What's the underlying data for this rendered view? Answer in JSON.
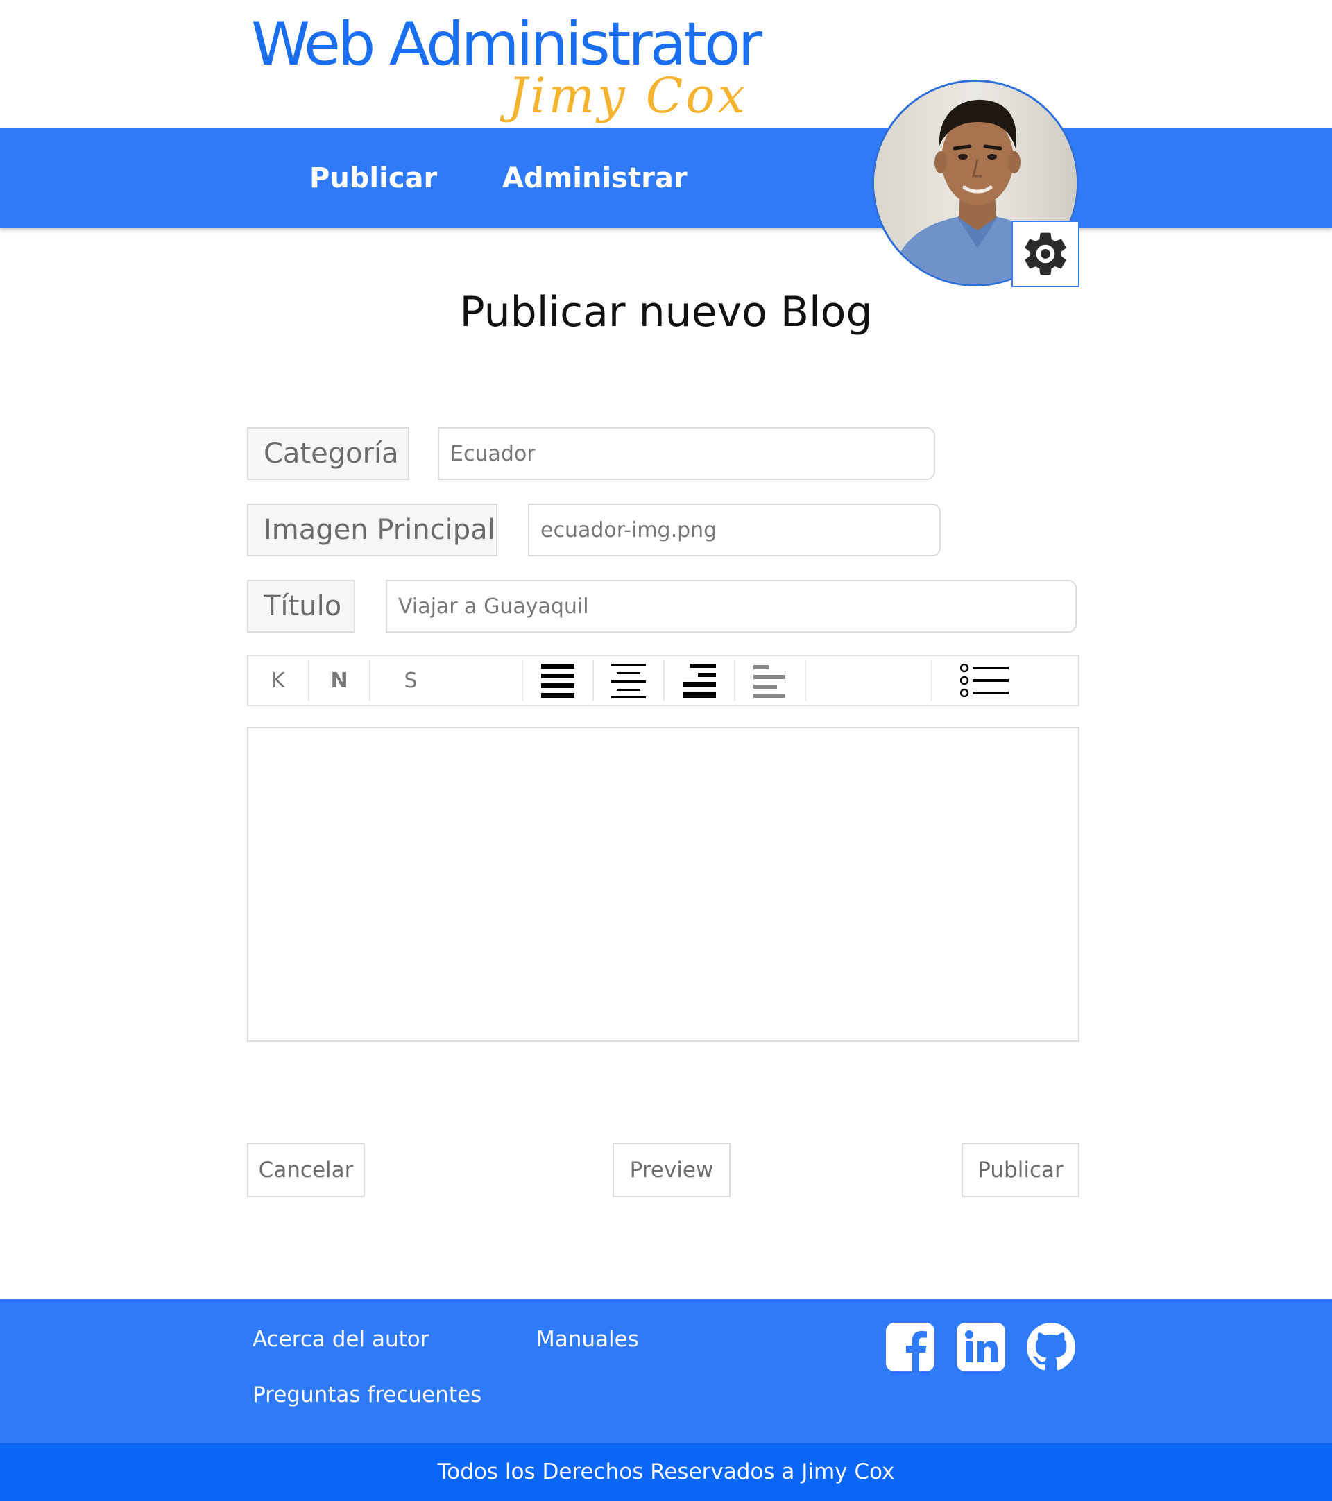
{
  "brand": {
    "title": "Web Administrator",
    "subtitle": "Jimy Cox",
    "primary_color": "#2f7af8",
    "accent_color": "#f5b330"
  },
  "nav": {
    "items": [
      {
        "label": "Publicar"
      },
      {
        "label": "Administrar"
      }
    ]
  },
  "profile": {
    "avatar_icon": "user-photo",
    "settings_icon": "gear-icon"
  },
  "page": {
    "title": "Publicar nuevo Blog"
  },
  "form": {
    "category": {
      "label": "Categoría",
      "value": "Ecuador"
    },
    "image": {
      "label": "Imagen Principal",
      "value": "ecuador-img.png"
    },
    "title": {
      "label": "Título",
      "value": "Viajar a Guayaquil"
    },
    "content": {
      "value": ""
    }
  },
  "toolbar": {
    "italic": "K",
    "bold": "N",
    "underline": "S",
    "icons": [
      "align-justify-icon",
      "align-center-icon",
      "align-right-icon",
      "align-left-icon",
      "list-icon"
    ]
  },
  "actions": {
    "cancel": "Cancelar",
    "preview": "Preview",
    "publish": "Publicar"
  },
  "footer": {
    "links": [
      {
        "label": "Acerca del autor"
      },
      {
        "label": "Manuales"
      },
      {
        "label": "Preguntas frecuentes"
      }
    ],
    "social": [
      "facebook-icon",
      "linkedin-icon",
      "github-icon"
    ],
    "copyright": "Todos los Derechos Reservados a Jimy Cox"
  }
}
